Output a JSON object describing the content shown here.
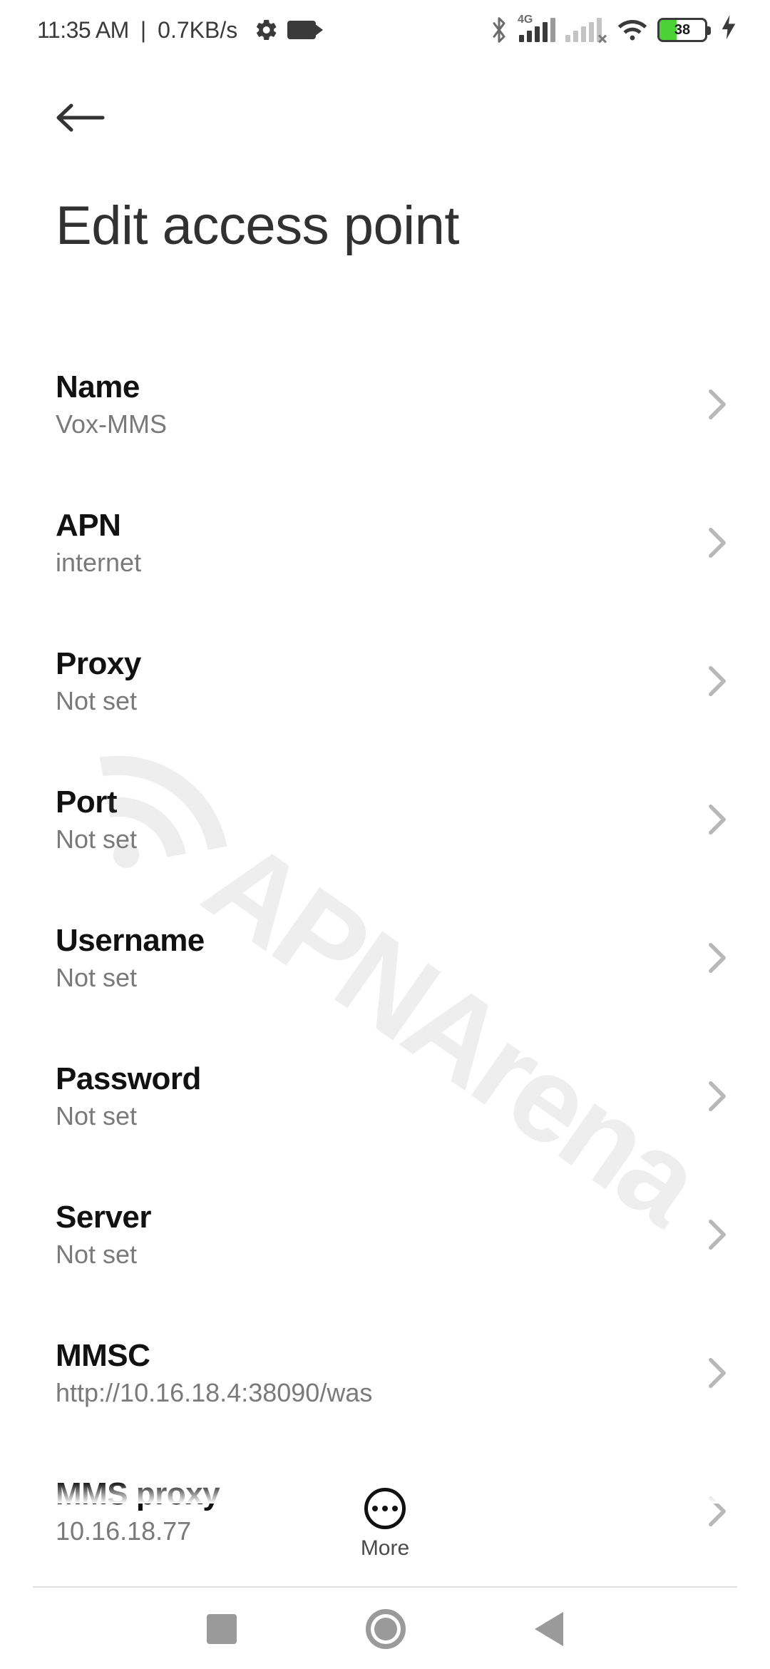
{
  "status": {
    "time": "11:35 AM",
    "separator": "|",
    "data_rate": "0.7KB/s",
    "network_label": "4G",
    "battery_percent": "38"
  },
  "header": {
    "title": "Edit access point"
  },
  "settings": [
    {
      "label": "Name",
      "value": "Vox-MMS"
    },
    {
      "label": "APN",
      "value": "internet"
    },
    {
      "label": "Proxy",
      "value": "Not set"
    },
    {
      "label": "Port",
      "value": "Not set"
    },
    {
      "label": "Username",
      "value": "Not set"
    },
    {
      "label": "Password",
      "value": "Not set"
    },
    {
      "label": "Server",
      "value": "Not set"
    },
    {
      "label": "MMSC",
      "value": "http://10.16.18.4:38090/was"
    },
    {
      "label": "MMS proxy",
      "value": "10.16.18.77"
    }
  ],
  "more": {
    "label": "More"
  },
  "watermark": {
    "text": "APNArena"
  }
}
